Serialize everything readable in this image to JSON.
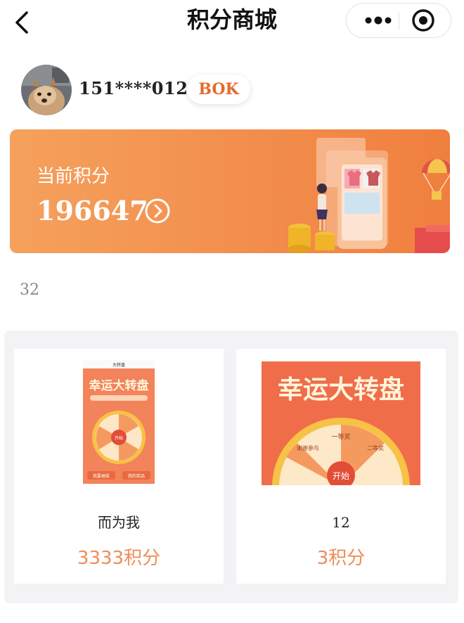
{
  "header": {
    "title": "积分商城",
    "back_icon": "chevron-left-icon",
    "more_icon": "more-dots-icon",
    "close_icon": "target-circle-icon"
  },
  "user": {
    "phone": "151****0122",
    "badge": "BOK"
  },
  "points": {
    "label": "当前积分",
    "value": "196647",
    "arrow_icon": "chevron-right-circle-icon"
  },
  "product_count": "32",
  "products": [
    {
      "name": "而为我",
      "price": "3333积分",
      "thumb_title": "幸运大转盘",
      "thumb_header": "大转盘",
      "thumb_start": "开始",
      "thumb_btn_left": "我要抽奖",
      "thumb_btn_right": "我的奖品"
    },
    {
      "name": "12",
      "price": "3积分",
      "thumb_title": "幸运大转盘",
      "thumb_start": "开始",
      "thumb_prize_top": "一等奖",
      "thumb_prize_left": "谢谢参与",
      "thumb_prize_right": "二等奖"
    }
  ],
  "colors": {
    "accent": "#f39150",
    "price": "#ed8d5a",
    "badge_text": "#e56a2d",
    "panel_bg": "#f3f3f6"
  }
}
